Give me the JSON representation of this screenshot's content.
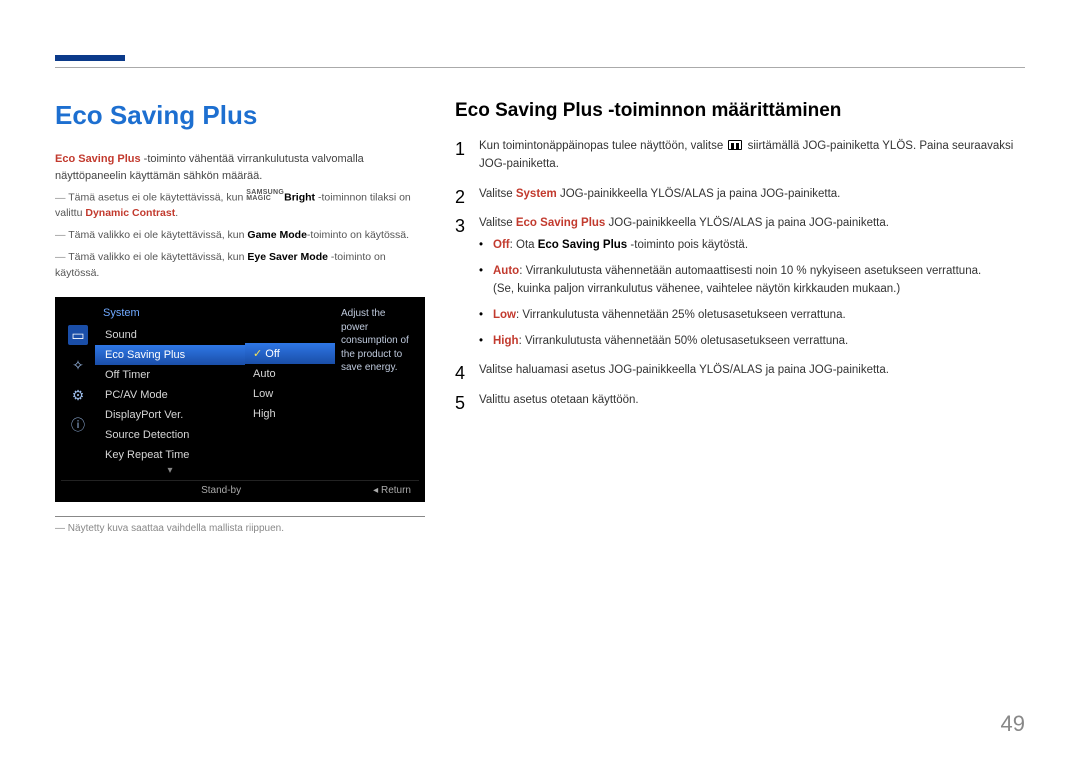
{
  "page_number": "49",
  "left": {
    "title": "Eco Saving Plus",
    "intro_prefix_red": "Eco Saving Plus",
    "intro_rest": " -toiminto vähentää virrankulutusta valvomalla näyttöpaneelin käyttämän sähkön määrää.",
    "note1_pre": "Tämä asetus ei ole käytettävissä, kun ",
    "note1_brandA": "SAMSUNG",
    "note1_brandB": "MAGIC",
    "note1_mid": "Bright",
    "note1_post": " -toiminnon tilaksi on valittu ",
    "note1_red": "Dynamic Contrast",
    "note1_end": ".",
    "note2_pre": "Tämä valikko ei ole käytettävissä, kun ",
    "note2_bold": "Game Mode",
    "note2_post": "-toiminto on käytössä.",
    "note3_pre": "Tämä valikko ei ole käytettävissä, kun ",
    "note3_bold": "Eye Saver Mode",
    "note3_post": " -toiminto on käytössä.",
    "footnote": "Näytetty kuva saattaa vaihdella mallista riippuen."
  },
  "osd": {
    "header": "System",
    "items": [
      "Sound",
      "Eco Saving Plus",
      "Off Timer",
      "PC/AV Mode",
      "DisplayPort Ver.",
      "Source Detection",
      "Key Repeat Time"
    ],
    "selected_index": 1,
    "sub": [
      "Off",
      "Auto",
      "Low",
      "High"
    ],
    "sub_selected_index": 0,
    "desc": "Adjust the power consumption of the product to save energy.",
    "footer_left": "Stand-by",
    "footer_right": "Return"
  },
  "right": {
    "subtitle": "Eco Saving Plus -toiminnon määrittäminen",
    "step1_a": "Kun toimintonäppäinopas tulee näyttöön, valitse ",
    "step1_b": " siirtämällä JOG-painiketta YLÖS. Paina seuraavaksi JOG-painiketta.",
    "step2_a": "Valitse ",
    "step2_red": "System",
    "step2_b": " JOG-painikkeella YLÖS/ALAS ja paina JOG-painiketta.",
    "step3_a": "Valitse ",
    "step3_red": "Eco Saving Plus",
    "step3_b": " JOG-painikkeella YLÖS/ALAS ja paina JOG-painiketta.",
    "bullets": [
      {
        "lead": "Off",
        "rest_a": ": Ota ",
        "bold": "Eco Saving Plus",
        "rest_b": " -toiminto pois käytöstä."
      },
      {
        "lead": "Auto",
        "rest_a": ": Virrankulutusta vähennetään automaattisesti noin 10 % nykyiseen asetukseen verrattuna.",
        "extra": "(Se, kuinka paljon virrankulutus vähenee, vaihtelee näytön kirkkauden mukaan.)"
      },
      {
        "lead": "Low",
        "rest_a": ": Virrankulutusta vähennetään 25% oletusasetukseen verrattuna."
      },
      {
        "lead": "High",
        "rest_a": ": Virrankulutusta vähennetään 50% oletusasetukseen verrattuna."
      }
    ],
    "step4": "Valitse haluamasi asetus JOG-painikkeella YLÖS/ALAS ja paina JOG-painiketta.",
    "step5": "Valittu asetus otetaan käyttöön."
  }
}
